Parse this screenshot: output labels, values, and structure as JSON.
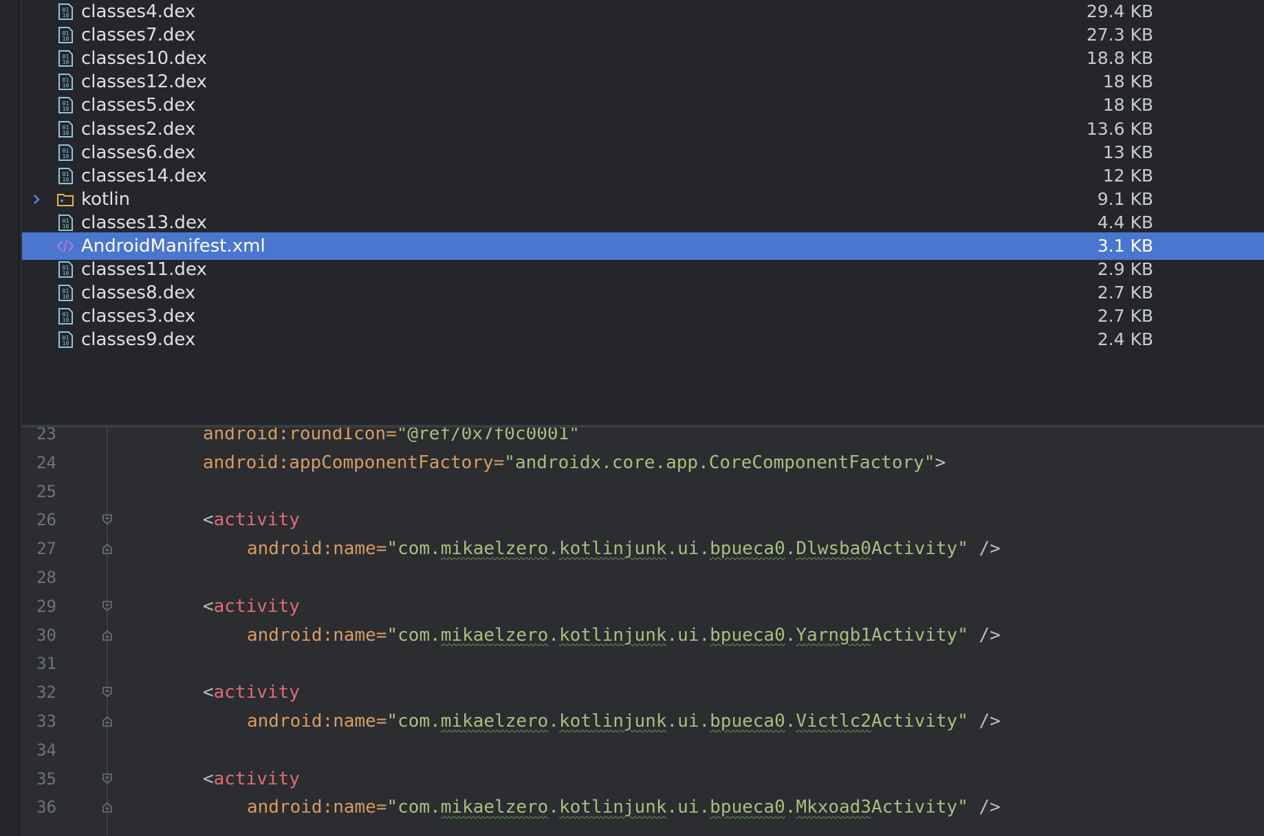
{
  "file_tree": {
    "rows": [
      {
        "name": "classes4.dex",
        "size": "29.4 KB",
        "icon": "dex-file-icon"
      },
      {
        "name": "classes7.dex",
        "size": "27.3 KB",
        "icon": "dex-file-icon"
      },
      {
        "name": "classes10.dex",
        "size": "18.8 KB",
        "icon": "dex-file-icon"
      },
      {
        "name": "classes12.dex",
        "size": "18 KB",
        "icon": "dex-file-icon"
      },
      {
        "name": "classes5.dex",
        "size": "18 KB",
        "icon": "dex-file-icon"
      },
      {
        "name": "classes2.dex",
        "size": "13.6 KB",
        "icon": "dex-file-icon"
      },
      {
        "name": "classes6.dex",
        "size": "13 KB",
        "icon": "dex-file-icon"
      },
      {
        "name": "classes14.dex",
        "size": "12 KB",
        "icon": "dex-file-icon"
      },
      {
        "name": "kotlin",
        "size": "9.1 KB",
        "icon": "folder-icon",
        "expandable": true
      },
      {
        "name": "classes13.dex",
        "size": "4.4 KB",
        "icon": "dex-file-icon"
      },
      {
        "name": "AndroidManifest.xml",
        "size": "3.1 KB",
        "icon": "xml-file-icon",
        "selected": true
      },
      {
        "name": "classes11.dex",
        "size": "2.9 KB",
        "icon": "dex-file-icon"
      },
      {
        "name": "classes8.dex",
        "size": "2.7 KB",
        "icon": "dex-file-icon"
      },
      {
        "name": "classes3.dex",
        "size": "2.7 KB",
        "icon": "dex-file-icon"
      },
      {
        "name": "classes9.dex",
        "size": "2.4 KB",
        "icon": "dex-file-icon"
      }
    ]
  },
  "editor": {
    "lines": [
      {
        "num": "23",
        "attr": "android:roundIcon=",
        "value": "\"@ref/0x7f0c0001\"",
        "tail": ""
      },
      {
        "num": "24",
        "attr": "android:appComponentFactory=",
        "value": "\"androidx.core.app.CoreComponentFactory\"",
        "tail": ">"
      },
      {
        "num": "25"
      },
      {
        "num": "26",
        "open": "<",
        "tag": "activity"
      },
      {
        "num": "27",
        "attr": "android:name=",
        "value_prefix": "\"com.",
        "segments": [
          "mikaelzero",
          ".",
          "kotlinjunk",
          ".ui.",
          "bpueca0",
          ".",
          "Dlwsba0",
          "Activity\""
        ],
        "tail": " />"
      },
      {
        "num": "28"
      },
      {
        "num": "29",
        "open": "<",
        "tag": "activity"
      },
      {
        "num": "30",
        "attr": "android:name=",
        "value_prefix": "\"com.",
        "segments": [
          "mikaelzero",
          ".",
          "kotlinjunk",
          ".ui.",
          "bpueca0",
          ".",
          "Yarngb1",
          "Activity\""
        ],
        "tail": " />"
      },
      {
        "num": "31"
      },
      {
        "num": "32",
        "open": "<",
        "tag": "activity"
      },
      {
        "num": "33",
        "attr": "android:name=",
        "value_prefix": "\"com.",
        "segments": [
          "mikaelzero",
          ".",
          "kotlinjunk",
          ".ui.",
          "bpueca0",
          ".",
          "Victlc2",
          "Activity\""
        ],
        "tail": " />"
      },
      {
        "num": "34"
      },
      {
        "num": "35",
        "open": "<",
        "tag": "activity"
      },
      {
        "num": "36",
        "attr": "android:name=",
        "value_prefix": "\"com.",
        "segments": [
          "mikaelzero",
          ".",
          "kotlinjunk",
          ".ui.",
          "bpueca0",
          ".",
          "Mkxoad3",
          "Activity\""
        ],
        "tail": " />"
      }
    ]
  },
  "colors": {
    "selection": "#4a76cf",
    "tree_bg": "#24262b",
    "editor_bg": "#2b2d31",
    "attr": "#d89c61",
    "string": "#a7c080",
    "tag": "#e06c75",
    "line_number": "#6f737a",
    "dex_icon": "#8fc7df",
    "xml_icon": "#b07ad9",
    "folder_icon": "#e8b84a"
  }
}
